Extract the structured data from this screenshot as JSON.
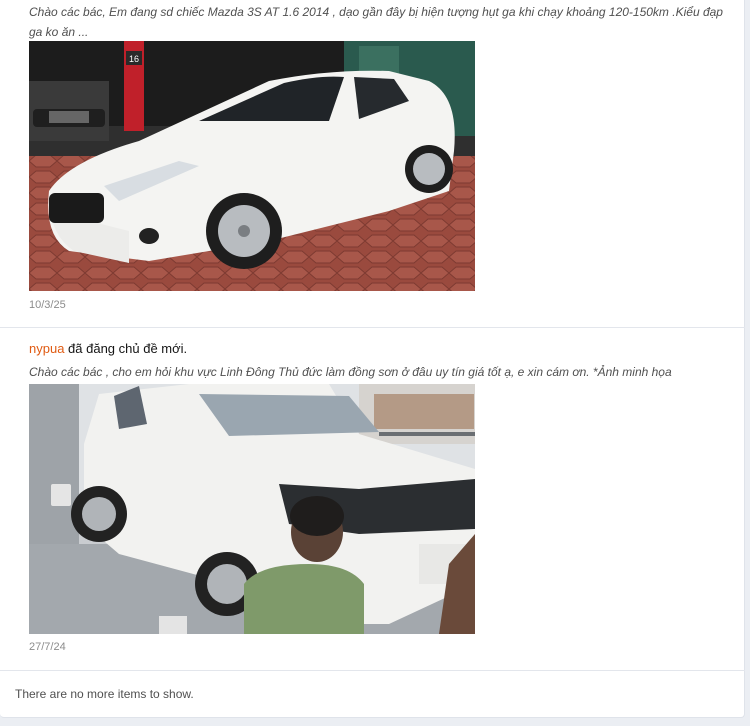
{
  "items": [
    {
      "snippet": "Chào các bác, Em đang sd chiếc Mazda 3S AT 1.6 2014 , dạo gần đây bị hiện tượng hụt ga khi chạy khoảng 120-150km .Kiểu đạp ga ko ăn ...",
      "date": "10/3/25",
      "photo_sign": "16"
    },
    {
      "user": "nypua",
      "action": " đã đăng chủ đề mới.",
      "snippet": "Chào các bác , cho em hỏi khu vực Linh Đông Thủ đức làm đồng sơn ở đâu uy tín giá tốt ạ, e xin cám ơn. *Ảnh minh họa",
      "date": "27/7/24"
    }
  ],
  "footer": {
    "no_more": "There are no more items to show."
  }
}
